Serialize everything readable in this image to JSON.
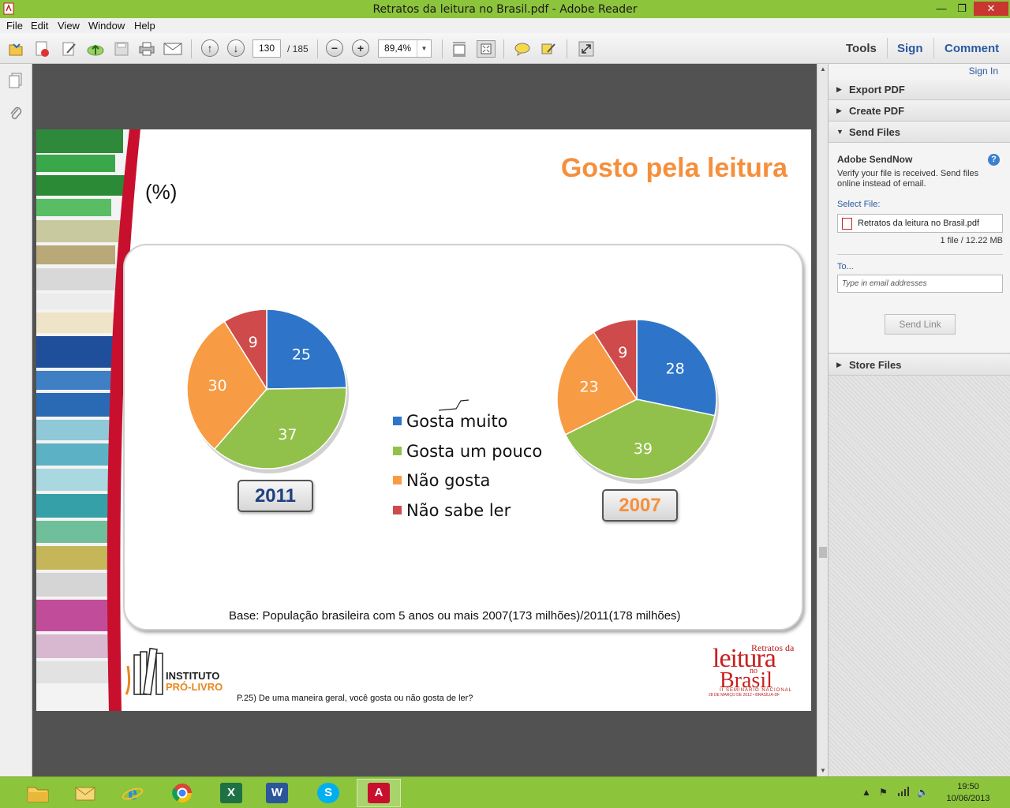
{
  "window": {
    "title": "Retratos da leitura no Brasil.pdf - Adobe Reader"
  },
  "menu": [
    "File",
    "Edit",
    "View",
    "Window",
    "Help"
  ],
  "toolbar": {
    "page_current": "130",
    "page_total": "/ 185",
    "zoom": "89,4%",
    "tools_label": "Tools",
    "sign_label": "Sign",
    "comment_label": "Comment"
  },
  "slide": {
    "title": "Gosto pela leitura",
    "unit": "(%)",
    "legend": [
      {
        "label": "Gosta muito",
        "color": "#2e75c9"
      },
      {
        "label": "Gosta um pouco",
        "color": "#92c14b"
      },
      {
        "label": "Não gosta",
        "color": "#f79c44"
      },
      {
        "label": "Não sabe ler",
        "color": "#cf4a4a"
      }
    ],
    "year_2011": "2011",
    "year_2007": "2007",
    "base": "Base: População brasileira com 5 anos ou mais 2007(173 milhões)/2011(178 milhões)",
    "question": "P.25) De uma maneira geral, você gosta ou não gosta de ler?",
    "logo_left_line1": "INSTITUTO",
    "logo_left_line2": "PRÓ-LIVRO",
    "logo_right": {
      "retratos": "Retratos da",
      "leitura": "leitura",
      "no": "no",
      "brasil": "Brasil",
      "seminario": "II SEMINÁRIO NACIONAL",
      "date": "28 DE MARÇO DE 2012 • BRASÍLIA-DF"
    }
  },
  "chart_data": [
    {
      "type": "pie",
      "title": "2011",
      "categories": [
        "Gosta muito",
        "Gosta um pouco",
        "Não gosta",
        "Não sabe ler"
      ],
      "values": [
        25,
        37,
        30,
        9
      ],
      "colors": [
        "#2e75c9",
        "#92c14b",
        "#f79c44",
        "#cf4a4a"
      ]
    },
    {
      "type": "pie",
      "title": "2007",
      "categories": [
        "Gosta muito",
        "Gosta um pouco",
        "Não gosta",
        "Não sabe ler"
      ],
      "values": [
        28,
        39,
        23,
        9
      ],
      "colors": [
        "#2e75c9",
        "#92c14b",
        "#f79c44",
        "#cf4a4a"
      ]
    }
  ],
  "right_pane": {
    "sign_in": "Sign In",
    "export_pdf": "Export PDF",
    "create_pdf": "Create PDF",
    "send_files": "Send Files",
    "sendnow_title": "Adobe SendNow",
    "sendnow_desc": "Verify your file is received. Send files online instead of email.",
    "select_file_label": "Select File:",
    "file_name": "Retratos da leitura no Brasil.pdf",
    "file_size": "1 file / 12.22 MB",
    "to_label": "To...",
    "email_placeholder": "Type in email addresses",
    "send_link": "Send Link",
    "store_files": "Store Files"
  },
  "taskbar": {
    "time": "19:50",
    "date": "10/06/2013"
  }
}
